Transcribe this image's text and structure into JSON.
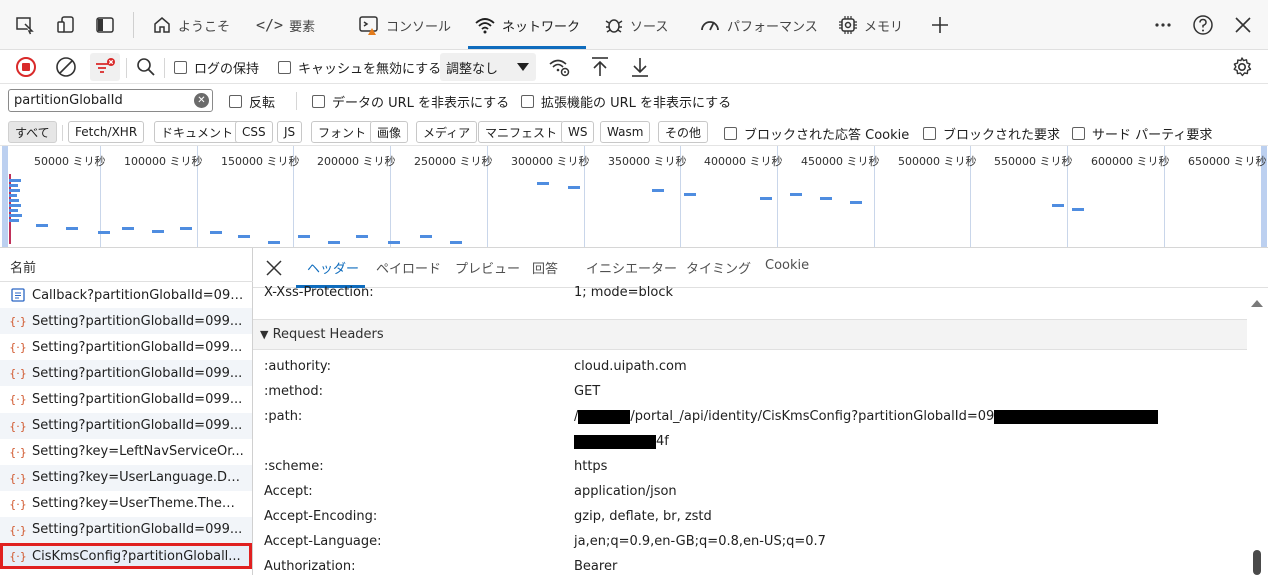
{
  "tabs": [
    {
      "label": "ようこそ",
      "icon": "home-icon"
    },
    {
      "label": "要素",
      "icon": "code-icon"
    },
    {
      "label": "コンソール",
      "icon": "console-icon"
    },
    {
      "label": "ネットワーク",
      "icon": "wifi-icon",
      "active": true
    },
    {
      "label": "ソース",
      "icon": "bug-icon"
    },
    {
      "label": "パフォーマンス",
      "icon": "gauge-icon"
    },
    {
      "label": "メモリ",
      "icon": "chip-icon"
    }
  ],
  "toolbar": {
    "preserve_log": "ログの保持",
    "disable_cache": "キャッシュを無効にする",
    "throttling": "調整なし"
  },
  "filter": {
    "search_value": "partitionGlobalId",
    "invert": "反転",
    "hide_data_urls": "データの URL を非表示にする",
    "hide_extension_urls": "拡張機能の URL を非表示にする"
  },
  "type_filters": [
    "すべて",
    "Fetch/XHR",
    "ドキュメント",
    "CSS",
    "JS",
    "フォント",
    "画像",
    "メディア",
    "マニフェスト",
    "WS",
    "Wasm",
    "その他"
  ],
  "type_options": {
    "blocked_cookies": "ブロックされた応答 Cookie",
    "blocked_requests": "ブロックされた要求",
    "third_party": "サード パーティ要求"
  },
  "timeline_ticks": [
    "50000 ミリ秒",
    "100000 ミリ秒",
    "150000 ミリ秒",
    "200000 ミリ秒",
    "250000 ミリ秒",
    "300000 ミリ秒",
    "350000 ミリ秒",
    "400000 ミリ秒",
    "450000 ミリ秒",
    "500000 ミリ秒",
    "550000 ミリ秒",
    "600000 ミリ秒",
    "650000 ミリ秒"
  ],
  "list": {
    "header": "名前",
    "rows": [
      {
        "name": "Callback?partitionGlobalId=099...",
        "icon": "document-icon"
      },
      {
        "name": "Setting?partitionGlobalId=099...",
        "icon": "fetch-icon"
      },
      {
        "name": "Setting?partitionGlobalId=099...",
        "icon": "fetch-icon"
      },
      {
        "name": "Setting?partitionGlobalId=099...",
        "icon": "fetch-icon"
      },
      {
        "name": "Setting?partitionGlobalId=099...",
        "icon": "fetch-icon"
      },
      {
        "name": "Setting?partitionGlobalId=099...",
        "icon": "fetch-icon"
      },
      {
        "name": "Setting?key=LeftNavServiceOr...",
        "icon": "fetch-icon"
      },
      {
        "name": "Setting?key=UserLanguage.Da...",
        "icon": "fetch-icon"
      },
      {
        "name": "Setting?key=UserTheme.Them...",
        "icon": "fetch-icon"
      },
      {
        "name": "Setting?partitionGlobalId=099...",
        "icon": "fetch-icon"
      },
      {
        "name": "CisKmsConfig?partitionGloball...",
        "icon": "fetch-icon",
        "selected": true
      }
    ]
  },
  "details": {
    "tabs": [
      "ヘッダー",
      "ペイロード",
      "プレビュー",
      "回答",
      "イニシエーター",
      "タイミング",
      "Cookie"
    ],
    "prev_header": {
      "name": "X-Xss-Protection:",
      "value": "1; mode=block"
    },
    "section_title": "Request Headers",
    "headers": [
      {
        "name": ":authority:",
        "value": "cloud.uipath.com"
      },
      {
        "name": ":method:",
        "value": "GET"
      },
      {
        "name": ":path:",
        "value_a": "/",
        "value_b": "/portal_/api/identity/CisKmsConfig?partitionGlobalId=09",
        "value_c": "4f"
      },
      {
        "name": ":scheme:",
        "value": "https"
      },
      {
        "name": "Accept:",
        "value": "application/json"
      },
      {
        "name": "Accept-Encoding:",
        "value": "gzip, deflate, br, zstd"
      },
      {
        "name": "Accept-Language:",
        "value": "ja,en;q=0.9,en-GB;q=0.8,en-US;q=0.7"
      },
      {
        "name": "Authorization:",
        "value": "Bearer"
      }
    ]
  }
}
